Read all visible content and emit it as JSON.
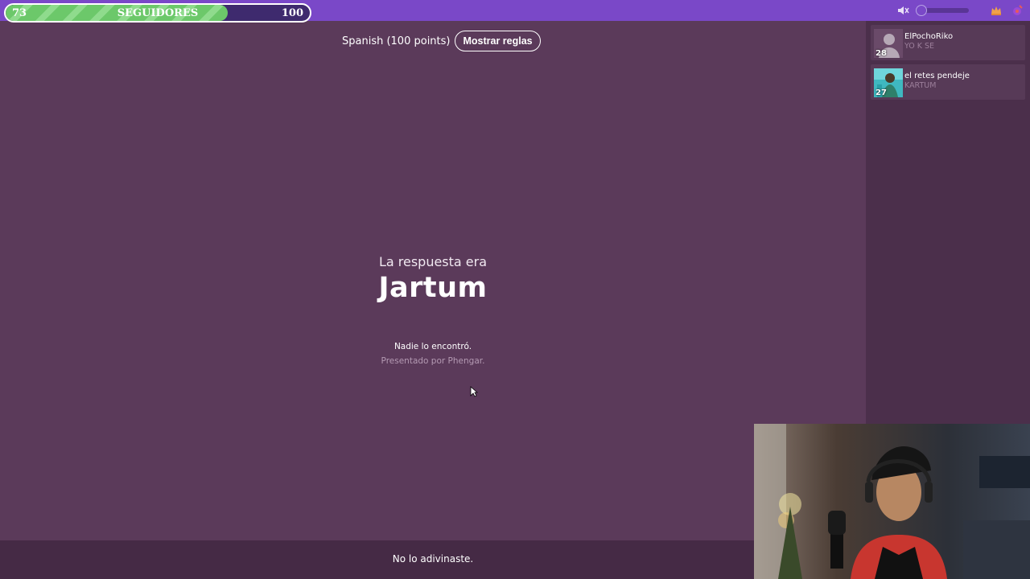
{
  "header": {
    "progress": {
      "current": "73",
      "label": "SEGUIDORES",
      "goal": "100",
      "fraction": 0.73
    },
    "icons": [
      "mute-icon",
      "volume-slider",
      "crown-icon",
      "settings-icon"
    ]
  },
  "game": {
    "language_info": "Spanish (100 points)",
    "rules_button": "Mostrar reglas",
    "answer_intro": "La respuesta era",
    "answer": "Jartum",
    "result_status": "Nadie lo encontró.",
    "presented_by": "Presentado por Phengar."
  },
  "footer": {
    "status": "No lo adivinaste."
  },
  "players": [
    {
      "score": "28",
      "name": "ElPochoRiko",
      "guess": "YO K SE"
    },
    {
      "score": "27",
      "name": "el retes pendeje",
      "guess": "KARTUM"
    }
  ],
  "colors": {
    "background": "#5b3a5a",
    "topbar": "#7a48c8",
    "sidebar": "#4b2f4b",
    "progress_fill": "#6cc86a"
  }
}
